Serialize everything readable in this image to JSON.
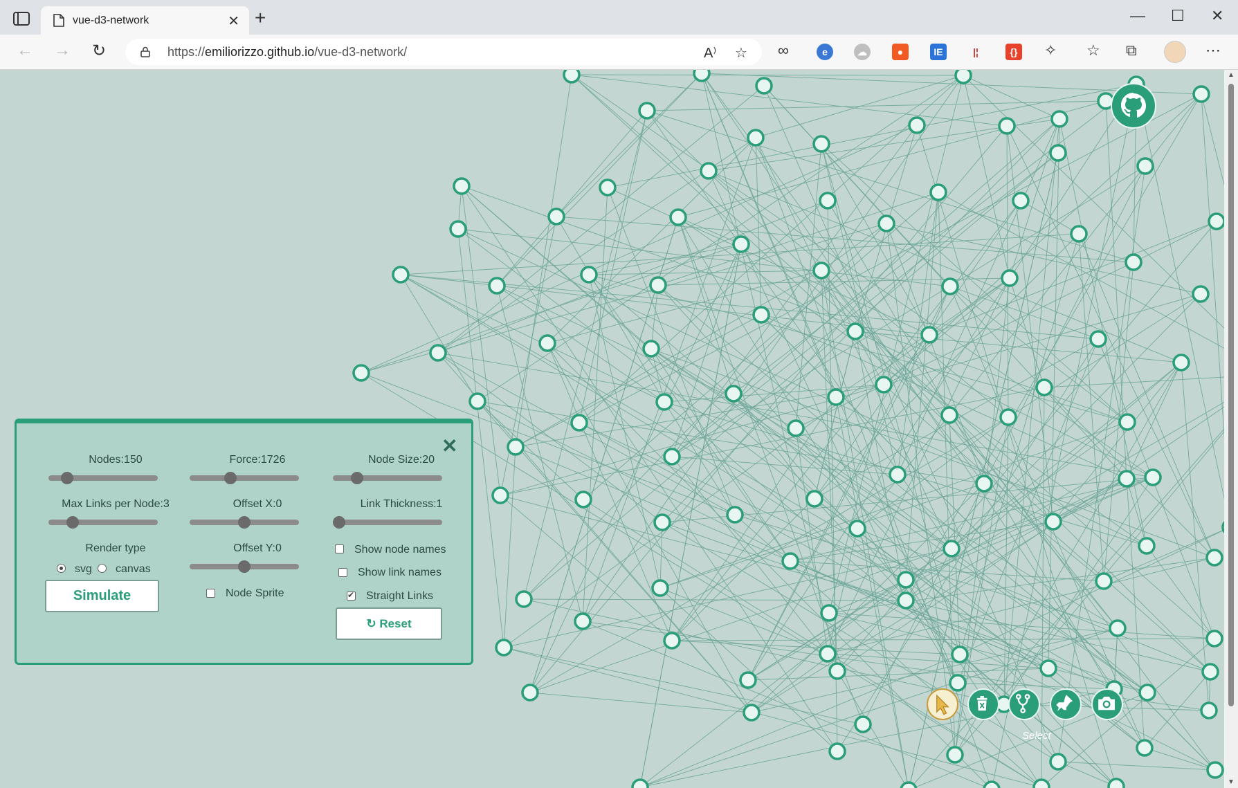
{
  "browser": {
    "tab_title": "vue-d3-network",
    "new_tab_symbol": "+",
    "url_prefix": "https://",
    "url_host": "emiliorizzo.github.io",
    "url_path": "/vue-d3-network/",
    "icons": [
      "tab-actions-icon",
      "page-icon",
      "close-icon",
      "back-icon",
      "forward-icon",
      "refresh-icon",
      "lock-icon",
      "read-aloud-icon",
      "add-favorite-icon",
      "extensions-icon",
      "favorites-icon",
      "collections-icon",
      "profile-avatar",
      "more-icon",
      "minimize-icon",
      "maximize-icon",
      "window-close-icon"
    ]
  },
  "panel": {
    "close_symbol": "✕",
    "nodes_label": "Nodes:150",
    "nodes_value": 150,
    "force_label": "Force:1726",
    "force_value": 1726,
    "node_size_label": "Node Size:20",
    "node_size_value": 20,
    "max_links_label": "Max Links per Node:3",
    "max_links_value": 3,
    "offset_x_label": "Offset X:0",
    "offset_x_value": 0,
    "link_thickness_label": "Link Thickness:1",
    "link_thickness_value": 1,
    "render_type_label": "Render type",
    "render_svg": "svg",
    "render_canvas": "canvas",
    "render_selected": "svg",
    "offset_y_label": "Offset Y:0",
    "offset_y_value": 0,
    "show_node_names": "Show node names",
    "show_node_names_checked": false,
    "show_link_names": "Show link names",
    "show_link_names_checked": false,
    "straight_links": "Straight Links",
    "straight_links_checked": true,
    "node_sprite": "Node Sprite",
    "node_sprite_checked": false,
    "simulate_button": "Simulate",
    "reset_button": "Reset",
    "reset_icon": "↻"
  },
  "tools": {
    "caption": "Select",
    "items": [
      "select-pointer-icon",
      "delete-trash-icon",
      "link-fork-icon",
      "pin-icon",
      "screenshot-camera-icon"
    ],
    "active": "select-pointer-icon"
  },
  "colors": {
    "page_bg": "#c4d6d1",
    "node_fill": "#e8f6f1",
    "node_stroke": "#2a9d79",
    "link": "#6fa79a",
    "accent": "#2a9d79",
    "panel_bg": "#afd3c9",
    "select_tool": "#c79a3c"
  }
}
